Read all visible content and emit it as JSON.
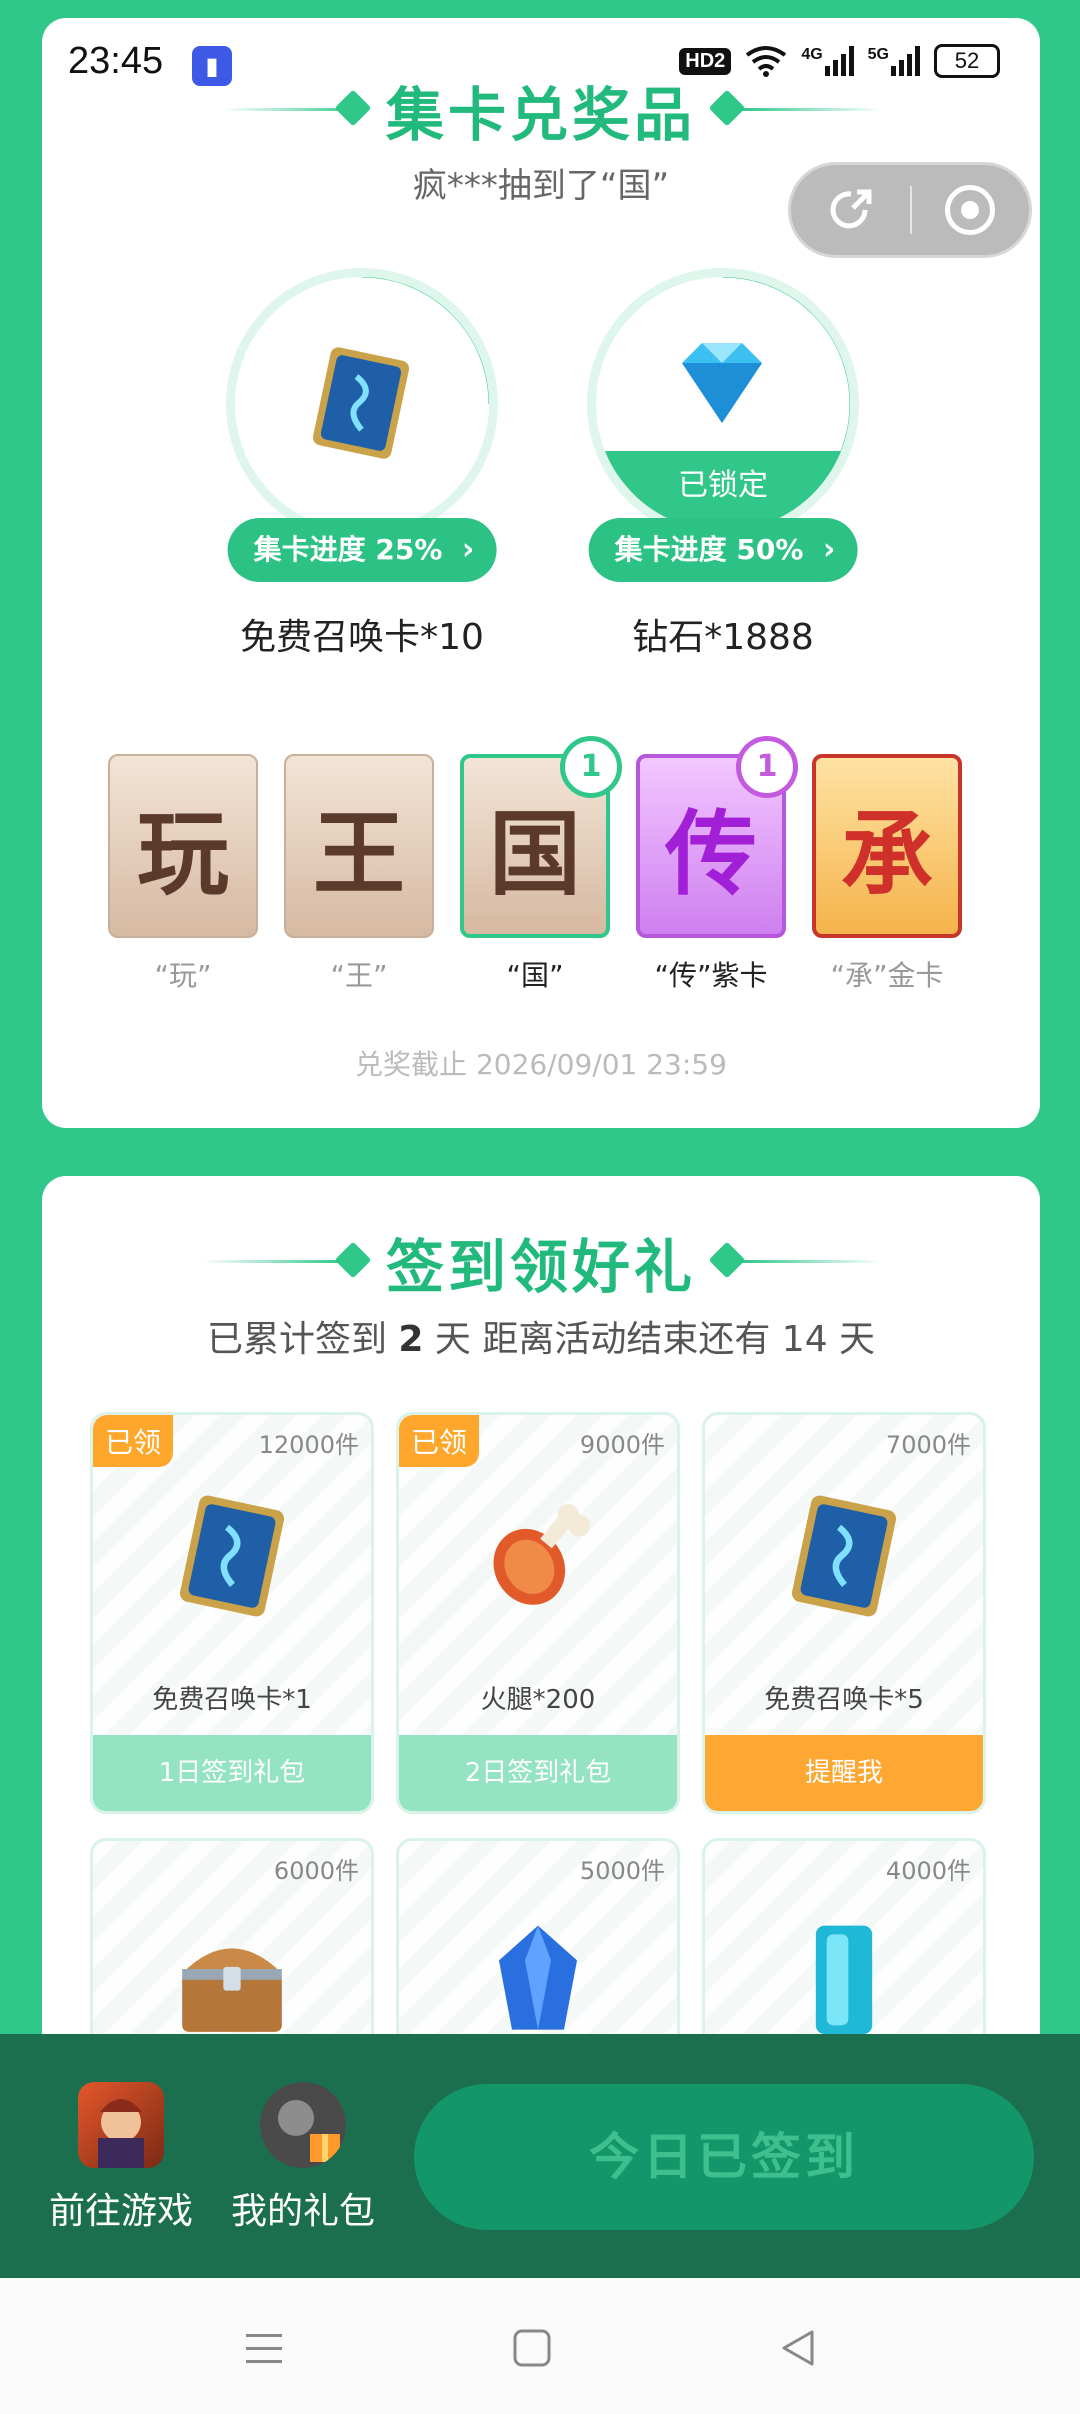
{
  "status_bar": {
    "time": "23:45",
    "hd_badge": "HD2",
    "net1": "4G",
    "net2": "5G",
    "battery": "52"
  },
  "collect": {
    "title": "集卡兑奖品",
    "ticker": "疯***抽到了“国”",
    "prizes": [
      {
        "progress_label": "集卡进度 25%",
        "progress": 0.25,
        "name": "免费召唤卡*10",
        "icon": "summon-card-icon"
      },
      {
        "progress_label": "集卡进度 50%",
        "progress": 0.5,
        "name": "钻石*1888",
        "icon": "diamond-icon",
        "lock": "已锁定"
      }
    ],
    "cards": [
      {
        "glyph": "玩",
        "caption": "“玩”",
        "count": ""
      },
      {
        "glyph": "王",
        "caption": "“王”",
        "count": ""
      },
      {
        "glyph": "国",
        "caption": "“国”",
        "count": "1"
      },
      {
        "glyph": "传",
        "caption": "“传”紫卡",
        "count": "1"
      },
      {
        "glyph": "承",
        "caption": "“承”金卡",
        "count": ""
      }
    ],
    "deadline": "兑奖截止 2026/09/01 23:59"
  },
  "signin": {
    "title": "签到领好礼",
    "stats_prefix": "已累计签到",
    "days": "2",
    "stats_suffix": "天  距离活动结束还有 14 天",
    "gifts": [
      {
        "qty": "12000件",
        "claimed": "已领",
        "name": "免费召唤卡*1",
        "foot": "1日签到礼包",
        "icon": "summon-card-icon"
      },
      {
        "qty": "9000件",
        "claimed": "已领",
        "name": "火腿*200",
        "foot": "2日签到礼包",
        "icon": "ham-icon"
      },
      {
        "qty": "7000件",
        "claimed": "",
        "name": "免费召唤卡*5",
        "foot": "提醒我",
        "icon": "summon-card-icon"
      },
      {
        "qty": "6000件",
        "icon": "treasure-chest-icon"
      },
      {
        "qty": "5000件",
        "icon": "blue-crystal-icon"
      },
      {
        "qty": "4000件",
        "icon": "cyan-crystal-icon"
      }
    ]
  },
  "bottom": {
    "go_game": "前往游戏",
    "my_gifts": "我的礼包",
    "checked_in": "今日已签到"
  },
  "colors": {
    "brand_green": "#2fc78a",
    "bottom_bar": "#1b6f4e",
    "claimed_orange": "#ffa72c",
    "purple_card": "#c45ae0"
  }
}
